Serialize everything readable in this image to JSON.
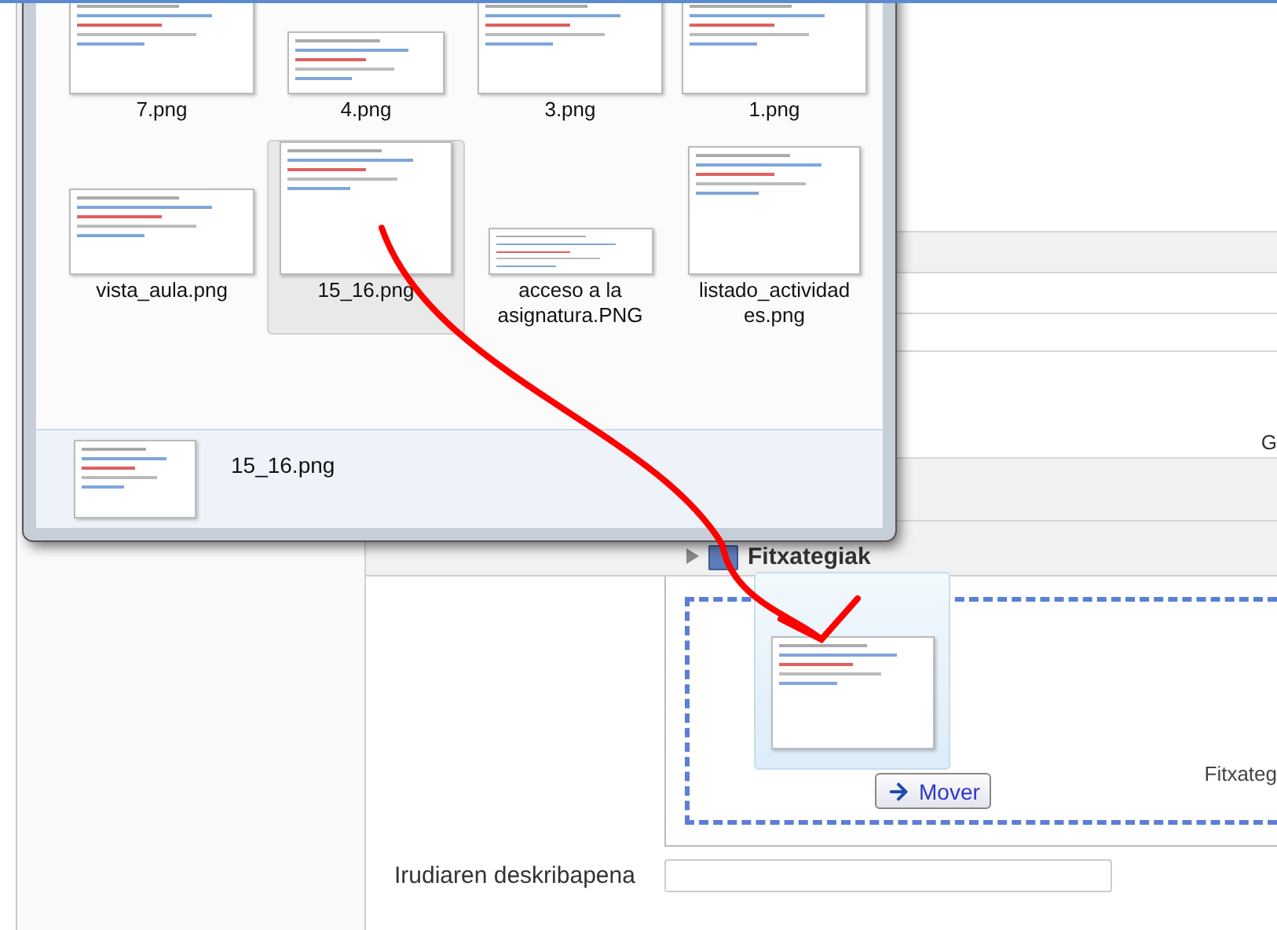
{
  "explorer": {
    "files": [
      {
        "name": "7.png",
        "selected": false
      },
      {
        "name": "4.png",
        "selected": false
      },
      {
        "name": "3.png",
        "selected": false
      },
      {
        "name": "1.png",
        "selected": false
      },
      {
        "name": "vista_aula.png",
        "selected": false
      },
      {
        "name": "15_16.png",
        "selected": true
      },
      {
        "name": "acceso a la asignatura.PNG",
        "selected": false
      },
      {
        "name": "listado_actividad es.png",
        "selected": false
      }
    ],
    "details": {
      "file_name": "15_16.png"
    }
  },
  "page": {
    "side_text": "G",
    "section": {
      "title": "Fitxategiak"
    },
    "drop_zone_text": "Fitxateg",
    "drag_button": "Mover",
    "description": {
      "label": "Irudiaren deskribapena"
    }
  }
}
